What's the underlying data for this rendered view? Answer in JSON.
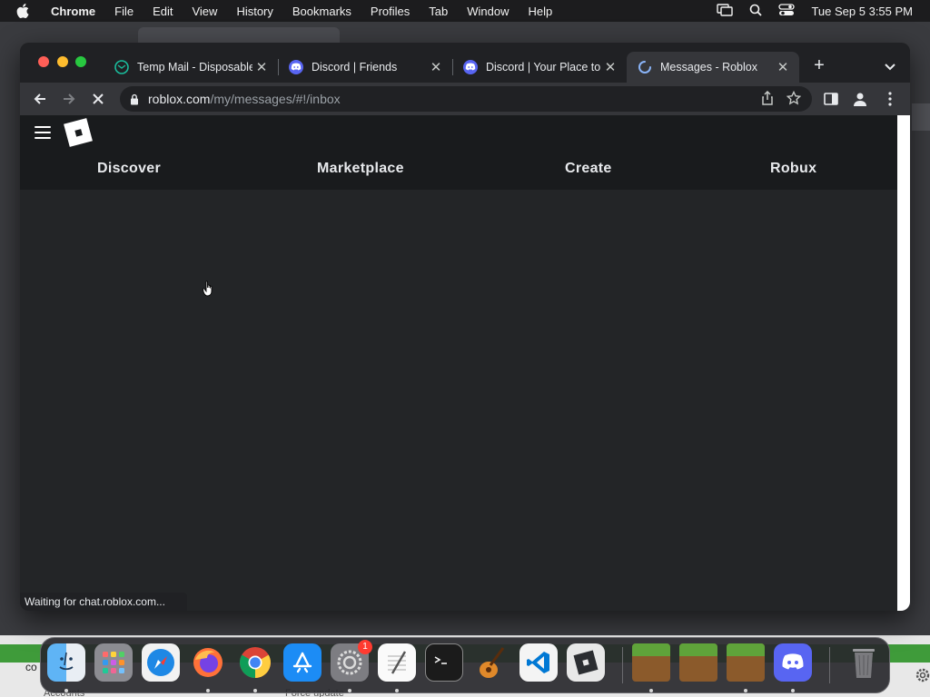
{
  "menubar": {
    "app_name": "Chrome",
    "items": [
      "File",
      "Edit",
      "View",
      "History",
      "Bookmarks",
      "Profiles",
      "Tab",
      "Window",
      "Help"
    ],
    "clock": "Tue Sep 5  3:55 PM"
  },
  "tabs": [
    {
      "title": "Temp Mail - Disposable",
      "favicon": "tempmail-icon",
      "color": "#1abc9c"
    },
    {
      "title": "Discord | Friends",
      "favicon": "discord-icon",
      "color": "#5865f2"
    },
    {
      "title": "Discord | Your Place to",
      "favicon": "discord-icon",
      "color": "#5865f2"
    },
    {
      "title": "Messages - Roblox",
      "favicon": "loading-spinner-icon",
      "color": "#8ab4f8",
      "active": true
    }
  ],
  "omnibox": {
    "host": "roblox.com",
    "path": "/my/messages/#!/inbox"
  },
  "roblox": {
    "nav": [
      "Discover",
      "Marketplace",
      "Create",
      "Robux"
    ]
  },
  "status_bar": "Waiting for chat.roblox.com...",
  "dock": {
    "apps": [
      "Finder",
      "Launchpad",
      "Safari",
      "Firefox",
      "Chrome",
      "App Store",
      "System Settings",
      "TextEdit",
      "Terminal",
      "GarageBand",
      "Visual Studio Code",
      "Roblox",
      "Minecraft",
      "Minecraft",
      "Minecraft",
      "Discord",
      "Trash"
    ],
    "settings_badge": "1"
  },
  "background": {
    "left_text": "co",
    "text_1": "Accounts",
    "text_2": "Force update"
  }
}
